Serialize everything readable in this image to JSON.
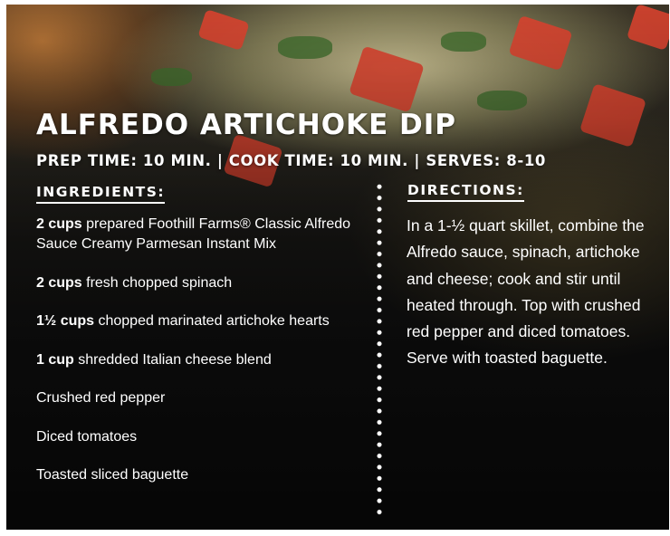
{
  "recipe": {
    "title": "ALFREDO ARTICHOKE DIP",
    "subtitle": "PREP TIME: 10 MIN. | COOK TIME: 10 MIN. | SERVES: 8-10",
    "ingredients_heading": "INGREDIENTS:",
    "directions_heading": "DIRECTIONS:",
    "ingredients": [
      {
        "amount": "2 cups",
        "text": " prepared Foothill Farms® Classic Alfredo Sauce Creamy Parmesan Instant Mix"
      },
      {
        "amount": "2 cups",
        "text": " fresh chopped spinach"
      },
      {
        "amount": "1½ cups",
        "text": " chopped marinated artichoke hearts"
      },
      {
        "amount": "1 cup",
        "text": " shredded Italian cheese blend"
      },
      {
        "amount": "",
        "text": "Crushed red pepper"
      },
      {
        "amount": "",
        "text": "Diced tomatoes"
      },
      {
        "amount": "",
        "text": "Toasted sliced baguette"
      }
    ],
    "directions": "In a 1-½ quart skillet, combine the Alfredo sauce, spinach, artichoke and cheese; cook and stir until heated through. Top with crushed red pepper and diced tomatoes. Serve with toasted baguette."
  },
  "colors": {
    "text": "#ffffff",
    "tomato": "#d9432f",
    "background": "#151515"
  }
}
